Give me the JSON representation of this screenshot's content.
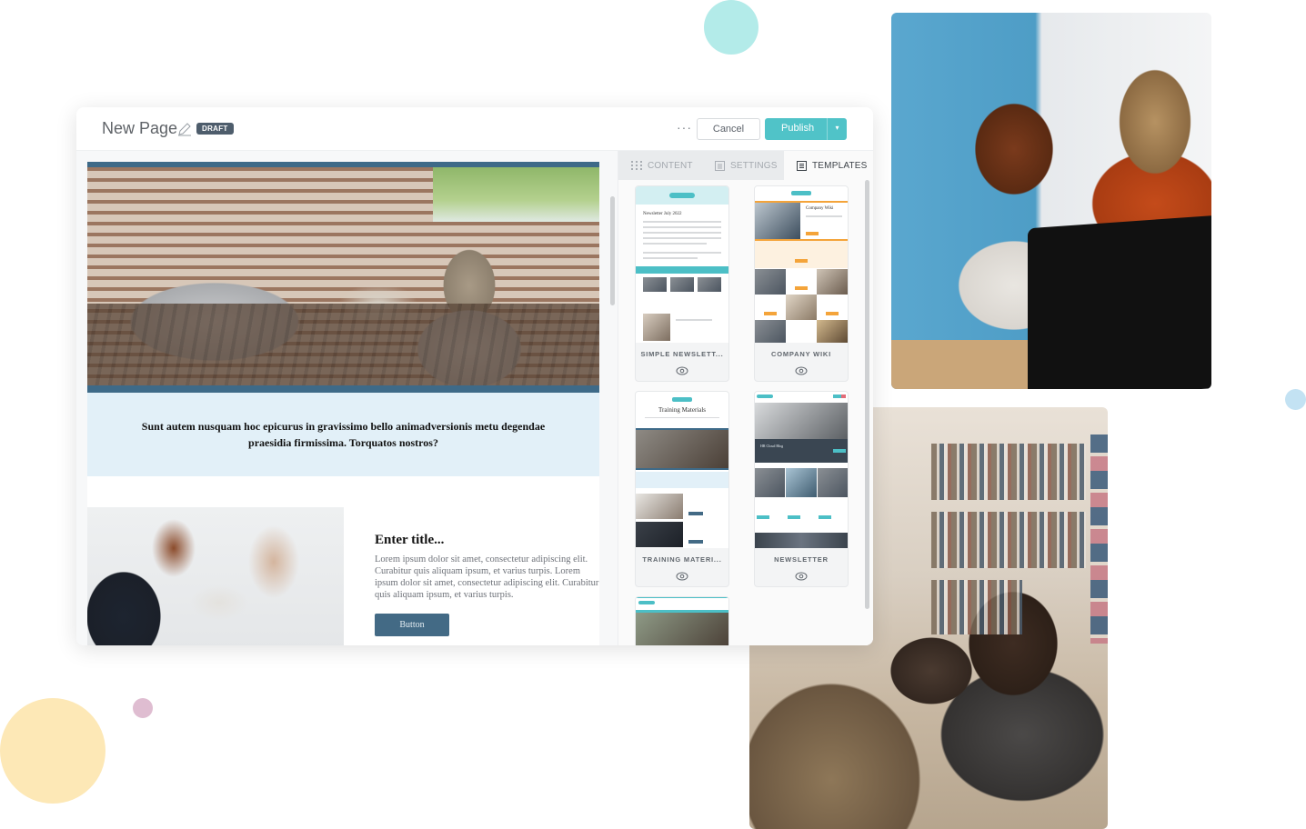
{
  "app": {
    "title": "New Page",
    "status_badge": "DRAFT",
    "more_label": "···",
    "cancel_label": "Cancel",
    "publish_label": "Publish",
    "publish_caret": "▾"
  },
  "tabs": [
    {
      "label": "CONTENT",
      "icon": "grid-icon",
      "active": false
    },
    {
      "label": "SETTINGS",
      "icon": "settings-list-icon",
      "active": false
    },
    {
      "label": "TEMPLATES",
      "icon": "template-doc-icon",
      "active": true
    }
  ],
  "canvas": {
    "quote": "Sunt autem nusquam hoc epicurus in gravissimo bello animadversionis metu degendae praesidia firmissima. Torquatos nostros?",
    "card_title": "Enter title...",
    "card_body": "Lorem ipsum dolor sit amet, consectetur adipiscing elit. Curabitur quis aliquam ipsum, et varius turpis. Lorem ipsum dolor sit amet, consectetur adipiscing elit. Curabitur quis aliquam ipsum, et varius turpis.",
    "card_button": "Button"
  },
  "templates": [
    {
      "name": "SIMPLE NEWSLETT...",
      "heading": "Newsletter July 2022"
    },
    {
      "name": "COMPANY WIKI",
      "heading": "Company Wiki"
    },
    {
      "name": "TRAINING MATERI...",
      "heading": "Training Materials"
    },
    {
      "name": "NEWSLETTER",
      "heading": "HR Cloud Blog"
    },
    {
      "name": "",
      "heading": ""
    }
  ],
  "colors": {
    "accent_teal": "#50c3c8",
    "draft_badge": "#4e5d6c",
    "hero_border": "#3e6a88",
    "quote_bg": "#e2f0f8",
    "card_button": "#436a85"
  }
}
